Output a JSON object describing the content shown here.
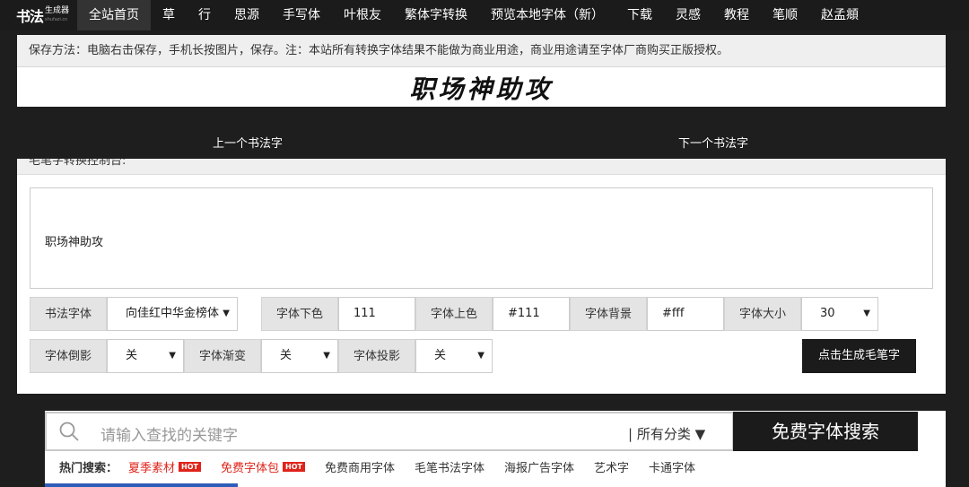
{
  "logo": {
    "main": "书法",
    "sub": "生成器",
    "domain": "shufazi.cn"
  },
  "nav": [
    "全站首页",
    "草",
    "行",
    "思源",
    "手写体",
    "叶根友",
    "繁体字转换",
    "预览本地字体（新）",
    "下载",
    "灵感",
    "教程",
    "笔顺",
    "赵孟頫"
  ],
  "notice": "保存方法：电脑右击保存，手机长按图片，保存。注：本站所有转换字体结果不能做为商业用途，商业用途请至字体厂商购买正版授权。",
  "preview_text": "职场神助攻",
  "pager": {
    "prev": "上一个书法字",
    "next": "下一个书法字"
  },
  "panel_title": "毛笔字转换控制台:",
  "textarea_value": "职场神助攻",
  "controls": {
    "font_label": "书法字体",
    "font_value": "向佳红中华金榜体",
    "bottom_color_label": "字体下色",
    "bottom_color_value": "111",
    "top_color_label": "字体上色",
    "top_color_value": "#111",
    "bg_label": "字体背景",
    "bg_value": "#fff",
    "size_label": "字体大小",
    "size_value": "30",
    "reflection_label": "字体倒影",
    "reflection_value": "关",
    "gradient_label": "字体渐变",
    "gradient_value": "关",
    "shadow_label": "字体投影",
    "shadow_value": "关",
    "generate_label": "点击生成毛笔字"
  },
  "search": {
    "placeholder": "请输入查找的关键字",
    "category": "| 所有分类 ▼",
    "button": "免费字体搜索"
  },
  "hot": {
    "label": "热门搜索：",
    "kw1": "夏季素材",
    "tag": "HOT",
    "kw2": "免费字体包",
    "tag2": "HOT",
    "kw3": "免费商用字体",
    "kw4": "毛笔书法字体",
    "kw5": "海报广告字体",
    "kw6": "艺术字",
    "kw7": "卡通字体"
  }
}
